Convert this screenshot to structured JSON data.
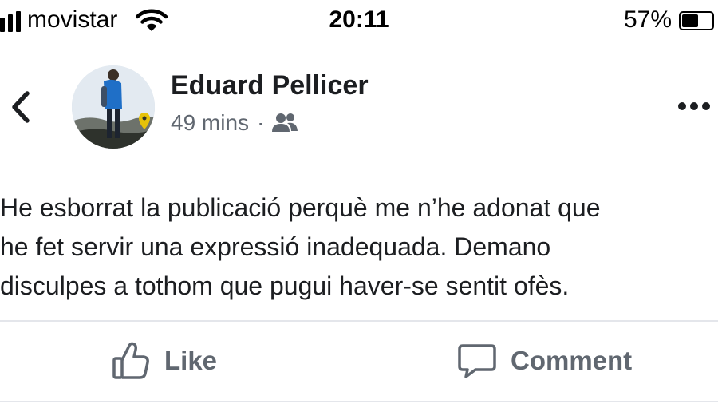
{
  "status_bar": {
    "carrier": "movistar",
    "time": "20:11",
    "battery": "57%",
    "battery_level": 0.57,
    "icons": [
      "signal-icon",
      "wifi-icon",
      "battery-icon"
    ]
  },
  "post": {
    "author": "Eduard Pellicer",
    "time_ago": "49 mins",
    "separator": "·",
    "audience_icon": "friends-icon",
    "text": "He esborrat la publicació perquè me n’he adonat que\nhe fet servir una expressió inadequada. Demano\ndisculpes a tothom que pugui haver-se sentit ofès."
  },
  "actions": {
    "like_label": "Like",
    "comment_label": "Comment"
  },
  "colors": {
    "text": "#1c1e21",
    "secondary": "#606770",
    "divider": "#e4e6eb"
  }
}
